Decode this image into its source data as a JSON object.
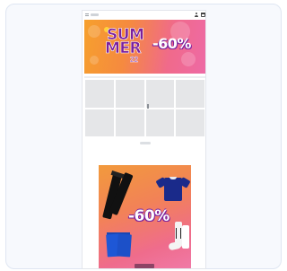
{
  "header": {
    "menu_icon": "hamburger-menu-icon",
    "user_icon": "user-icon",
    "cart_icon": "shopping-bag-icon"
  },
  "hero_banner": {
    "headline_line1": "SUM",
    "headline_line2": "MER",
    "year": "22",
    "discount": "-60%",
    "colors": {
      "gradient_start": "#f6a02d",
      "gradient_end": "#ee6aa5",
      "headline": "#7a1f9e"
    }
  },
  "product_grid": {
    "rows": 2,
    "columns": 4,
    "tile_color": "#e5e6e8"
  },
  "promo_section": {
    "title": "",
    "discount": "-60%",
    "items": [
      "track-pants",
      "t-shirt",
      "shorts",
      "socks"
    ],
    "caption": ""
  }
}
